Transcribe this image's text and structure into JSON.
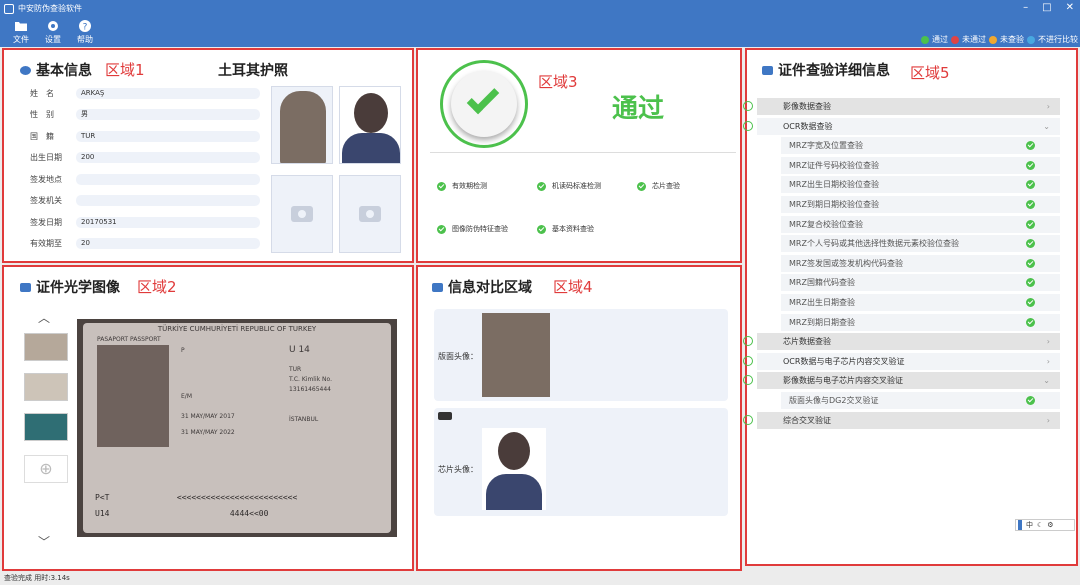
{
  "app": {
    "title": "中安防伪查验软件"
  },
  "toolbar": {
    "file": "文件",
    "settings": "设置",
    "help": "帮助"
  },
  "legend": {
    "pass": "通过",
    "fail": "未通过",
    "unchecked": "未查验",
    "no_compare": "不进行比较"
  },
  "zones": {
    "z1": "区域1",
    "z2": "区域2",
    "z3": "区域3",
    "z4": "区域4",
    "z5": "区域5"
  },
  "basic": {
    "title": "基本信息",
    "country_title": "土耳其护照",
    "fields": [
      {
        "label": "姓　名",
        "value": "ARKAŞ"
      },
      {
        "label": "性　别",
        "value": "男"
      },
      {
        "label": "国　籍",
        "value": "TUR"
      },
      {
        "label": "出生日期",
        "value": "200"
      },
      {
        "label": "签发地点",
        "value": ""
      },
      {
        "label": "签发机关",
        "value": ""
      },
      {
        "label": "签发日期",
        "value": "20170531"
      },
      {
        "label": "有效期至",
        "value": "20"
      }
    ]
  },
  "result": {
    "status": "通过",
    "checks": [
      "有效期检测",
      "机读码标准检测",
      "芯片查验",
      "图像防伪特征查验",
      "基本资料查验"
    ]
  },
  "optical": {
    "title": "证件光学图像",
    "passport": {
      "header": "TÜRKİYE CUMHURİYETİ  REPUBLIC OF TURKEY",
      "type": "PASAPORT  PASSPORT",
      "type_code": "P",
      "number": "U 14",
      "nationality": "TUR",
      "authority": "T.C. Kimlik No.",
      "id_no": "13161465444",
      "sex": "E/M",
      "birth_place": "İSTANBUL",
      "issue_date": "31 MAY/MAY 2017",
      "expiry": "31 MAY/MAY 2022",
      "mrz1": "P<T              <<<<<<<<<<<<<<<<<<<<<<<<<",
      "mrz2": "U14                         4444<<00"
    }
  },
  "compare": {
    "title": "信息对比区域",
    "front_label": "版面头像：",
    "chip_label": "芯片头像："
  },
  "detail": {
    "title": "证件查验详细信息",
    "rows": [
      {
        "kind": "main",
        "label": "影像数据查验",
        "chev": "›"
      },
      {
        "kind": "main2",
        "label": "OCR数据查验",
        "chev": "⌄"
      },
      {
        "kind": "sub",
        "label": "MRZ字宽及位置查验"
      },
      {
        "kind": "sub",
        "label": "MRZ证件号码校验位查验"
      },
      {
        "kind": "sub",
        "label": "MRZ出生日期校验位查验"
      },
      {
        "kind": "sub",
        "label": "MRZ到期日期校验位查验"
      },
      {
        "kind": "sub",
        "label": "MRZ复合校验位查验"
      },
      {
        "kind": "sub",
        "label": "MRZ个人号码或其他选择性数据元素校验位查验"
      },
      {
        "kind": "sub",
        "label": "MRZ签发国或签发机构代码查验"
      },
      {
        "kind": "sub",
        "label": "MRZ国籍代码查验"
      },
      {
        "kind": "sub",
        "label": "MRZ出生日期查验"
      },
      {
        "kind": "sub",
        "label": "MRZ到期日期查验"
      },
      {
        "kind": "main",
        "label": "芯片数据查验",
        "chev": "›"
      },
      {
        "kind": "main2",
        "label": "OCR数据与电子芯片内容交叉验证",
        "chev": "›"
      },
      {
        "kind": "main",
        "label": "影像数据与电子芯片内容交叉验证",
        "chev": "⌄"
      },
      {
        "kind": "sub",
        "label": "版面头像与DG2交叉验证"
      },
      {
        "kind": "main",
        "label": "综合交叉验证",
        "chev": "›"
      }
    ]
  },
  "ime": {
    "mode": "中"
  },
  "status": {
    "text": "查验完成 用时:3.14s"
  }
}
